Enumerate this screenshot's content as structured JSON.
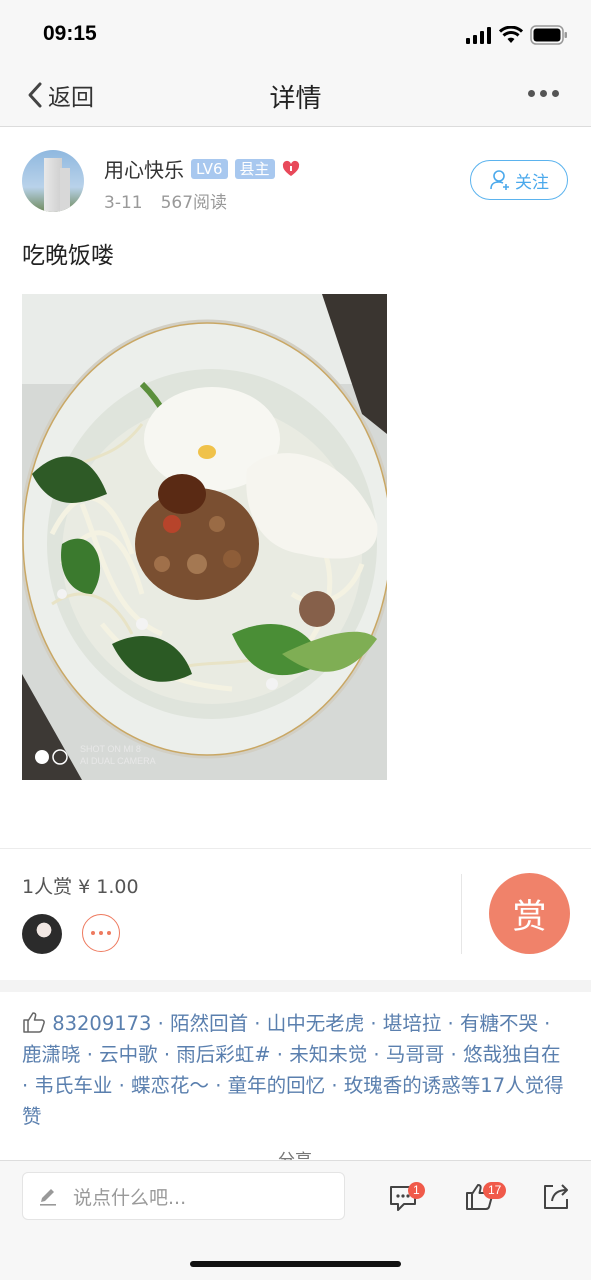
{
  "status": {
    "time": "09:15"
  },
  "nav": {
    "back_label": "返回",
    "title": "详情"
  },
  "author": {
    "name": "用心快乐",
    "level": "LV6",
    "role": "县主",
    "date": "3-11",
    "reads": "567阅读",
    "follow_label": "关注"
  },
  "post": {
    "text": "吃晚饭喽",
    "photo_watermark_1": "SHOT ON MI 8",
    "photo_watermark_2": "AI DUAL CAMERA"
  },
  "reward": {
    "summary": "1人赏 ¥ 1.00",
    "button_label": "赏"
  },
  "likes": {
    "names": [
      "83209173",
      "陌然回首",
      "山中无老虎",
      "堪培拉",
      "有糖不哭",
      "鹿潇晓",
      "云中歌",
      "雨后彩虹#",
      "未知未觉",
      "马哥哥",
      "悠哉独自在",
      "韦氏车业",
      "蝶恋花～",
      "童年的回忆",
      "玫瑰香的诱惑"
    ],
    "suffix": "等17人觉得赞"
  },
  "share_peek": "分享",
  "bottom": {
    "comment_placeholder": "说点什么吧...",
    "comment_count": "1",
    "like_count": "17"
  },
  "colors": {
    "accent_blue": "#4ba9ec",
    "reward_orange": "#f0826a",
    "link_blue": "#5a7fae",
    "badge_red": "#f05a4a"
  }
}
